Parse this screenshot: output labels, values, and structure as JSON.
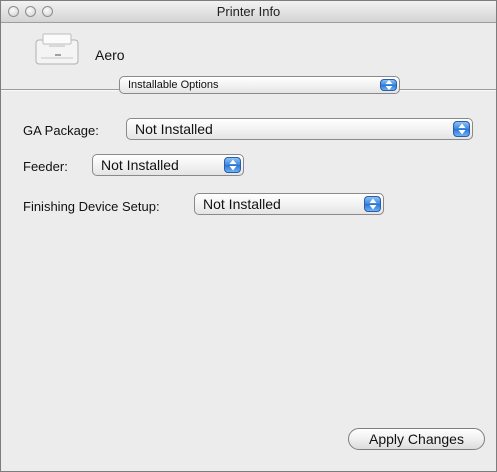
{
  "window": {
    "title": "Printer Info"
  },
  "printer": {
    "name": "Aero",
    "icon": "printer-icon"
  },
  "section_popup": {
    "selected": "Installable Options"
  },
  "options": [
    {
      "label": "GA Package:",
      "value": "Not Installed"
    },
    {
      "label": "Feeder:",
      "value": "Not Installed"
    },
    {
      "label": "Finishing Device Setup:",
      "value": "Not Installed"
    }
  ],
  "footer": {
    "apply_label": "Apply Changes"
  },
  "colors": {
    "popup_arrow_blue": "#3a86e0",
    "window_background": "#ececec"
  }
}
